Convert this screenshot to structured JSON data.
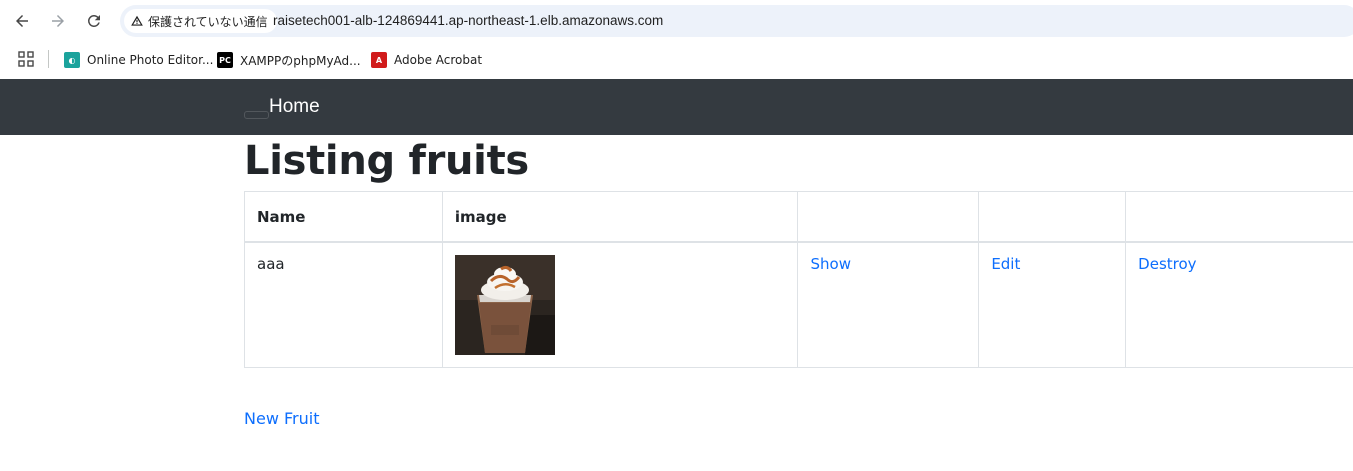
{
  "browser": {
    "security_label": "保護されていない通信",
    "url": "raisetech001-alb-124869441.ap-northeast-1.elb.amazonaws.com",
    "bookmarks": [
      {
        "label": "Online Photo Editor...",
        "icon": "photo-editor-icon"
      },
      {
        "label": "XAMPPのphpMyAd...",
        "icon": "phpstorm-icon"
      },
      {
        "label": "Adobe Acrobat",
        "icon": "acrobat-icon"
      }
    ]
  },
  "navbar": {
    "brand": "Home"
  },
  "page": {
    "title": "Listing fruits",
    "table": {
      "headers": [
        "Name",
        "image",
        "",
        "",
        ""
      ],
      "rows": [
        {
          "name": "aaa",
          "image_alt": "iced coffee frappuccino with whipped cream and caramel",
          "show": "Show",
          "edit": "Edit",
          "destroy": "Destroy"
        }
      ]
    },
    "new_link": "New Fruit"
  },
  "colors": {
    "navbar_bg": "#343a40",
    "link": "#0d6efd",
    "omnibox_bg": "#edf2fa"
  }
}
